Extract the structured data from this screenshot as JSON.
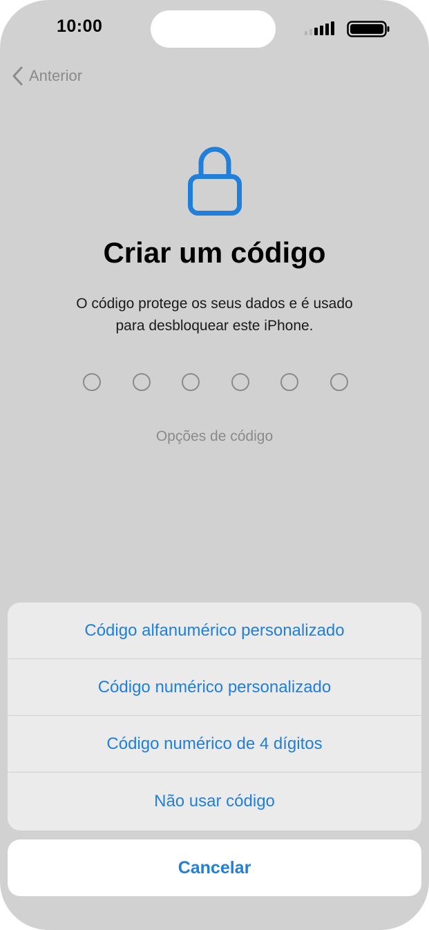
{
  "status_bar": {
    "time": "10:00"
  },
  "nav": {
    "back_label": "Anterior"
  },
  "main": {
    "title": "Criar um código",
    "subtitle_line1": "O código protege os seus dados e é usado",
    "subtitle_line2": "para desbloquear este iPhone.",
    "passcode_digits_count": 6,
    "options_link": "Opções de código"
  },
  "action_sheet": {
    "items": [
      {
        "label": "Código alfanumérico personalizado"
      },
      {
        "label": "Código numérico personalizado"
      },
      {
        "label": "Código numérico de 4 dígitos"
      },
      {
        "label": "Não usar código"
      }
    ],
    "cancel_label": "Cancelar"
  },
  "icons": {
    "lock": "lock-icon",
    "back": "chevron-left-icon",
    "signal": "cellular-signal-icon",
    "battery": "battery-icon"
  },
  "colors": {
    "accent": "#1f7fd9",
    "dimmed_background": "#d1d1d1"
  }
}
